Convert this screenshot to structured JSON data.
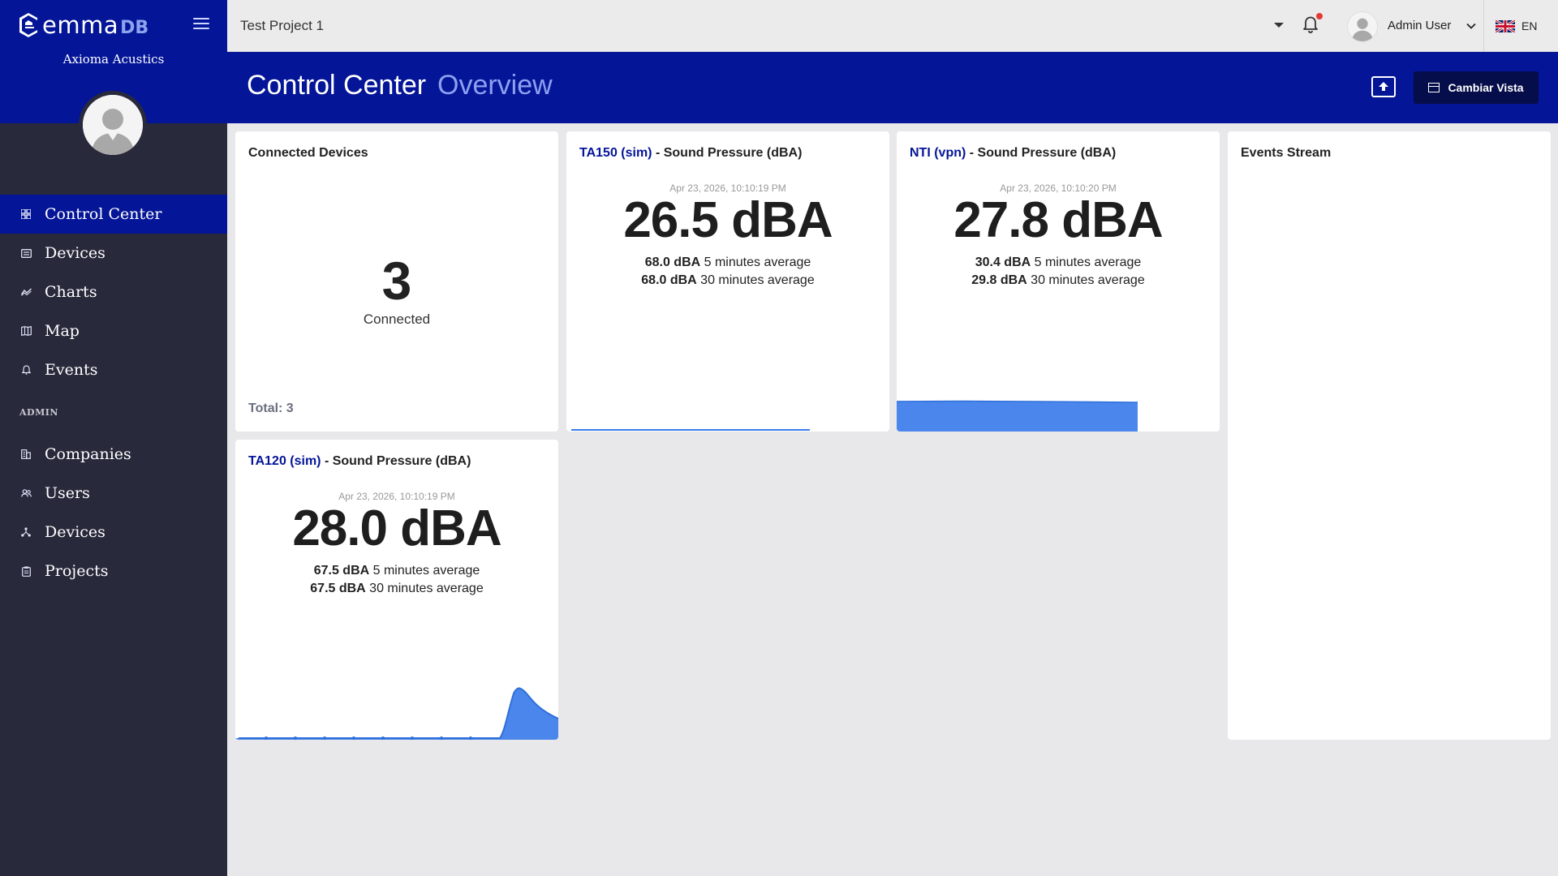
{
  "brand": {
    "logo_text": "emma",
    "logo_suffix": "DB",
    "company": "Axioma Acustics"
  },
  "sidebar": {
    "items": [
      {
        "label": "Control Center",
        "icon": "grid-icon",
        "active": true
      },
      {
        "label": "Devices",
        "icon": "device-icon"
      },
      {
        "label": "Charts",
        "icon": "chart-icon"
      },
      {
        "label": "Map",
        "icon": "map-icon"
      },
      {
        "label": "Events",
        "icon": "bell-icon"
      }
    ],
    "admin_section_label": "ADMIN",
    "admin_items": [
      {
        "label": "Companies",
        "icon": "building-icon"
      },
      {
        "label": "Users",
        "icon": "users-icon"
      },
      {
        "label": "Devices",
        "icon": "network-icon"
      },
      {
        "label": "Projects",
        "icon": "clipboard-icon"
      }
    ]
  },
  "topbar": {
    "project": "Test Project 1",
    "user_name": "Admin User",
    "language": "EN"
  },
  "header": {
    "title": "Control Center",
    "subtitle": "Overview",
    "view_button": "Cambiar Vista"
  },
  "connected_devices": {
    "title": "Connected Devices",
    "count": "3",
    "count_label": "Connected",
    "total": "Total: 3"
  },
  "events_stream": {
    "title": "Events Stream"
  },
  "sensors": [
    {
      "device": "TA150 (sim)",
      "metric": " - Sound Pressure (dBA)",
      "timestamp": "Apr 23, 2026, 10:10:19 PM",
      "reading": "26.5 dBA",
      "avg5_value": "68.0 dBA",
      "avg5_label": " 5 minutes average",
      "avg30_value": "68.0 dBA",
      "avg30_label": " 30 minutes average"
    },
    {
      "device": "NTI (vpn)",
      "metric": " - Sound Pressure (dBA)",
      "timestamp": "Apr 23, 2026, 10:10:20 PM",
      "reading": "27.8 dBA",
      "avg5_value": "30.4 dBA",
      "avg5_label": " 5 minutes average",
      "avg30_value": "29.8 dBA",
      "avg30_label": " 30 minutes average"
    },
    {
      "device": "TA120 (sim)",
      "metric": " - Sound Pressure (dBA)",
      "timestamp": "Apr 23, 2026, 10:10:19 PM",
      "reading": "28.0 dBA",
      "avg5_value": "67.5 dBA",
      "avg5_label": " 5 minutes average",
      "avg30_value": "67.5 dBA",
      "avg30_label": " 30 minutes average"
    }
  ],
  "colors": {
    "brand_blue": "#041597",
    "sidebar_dark": "#282a3c",
    "spark_blue": "#3b7deb"
  }
}
